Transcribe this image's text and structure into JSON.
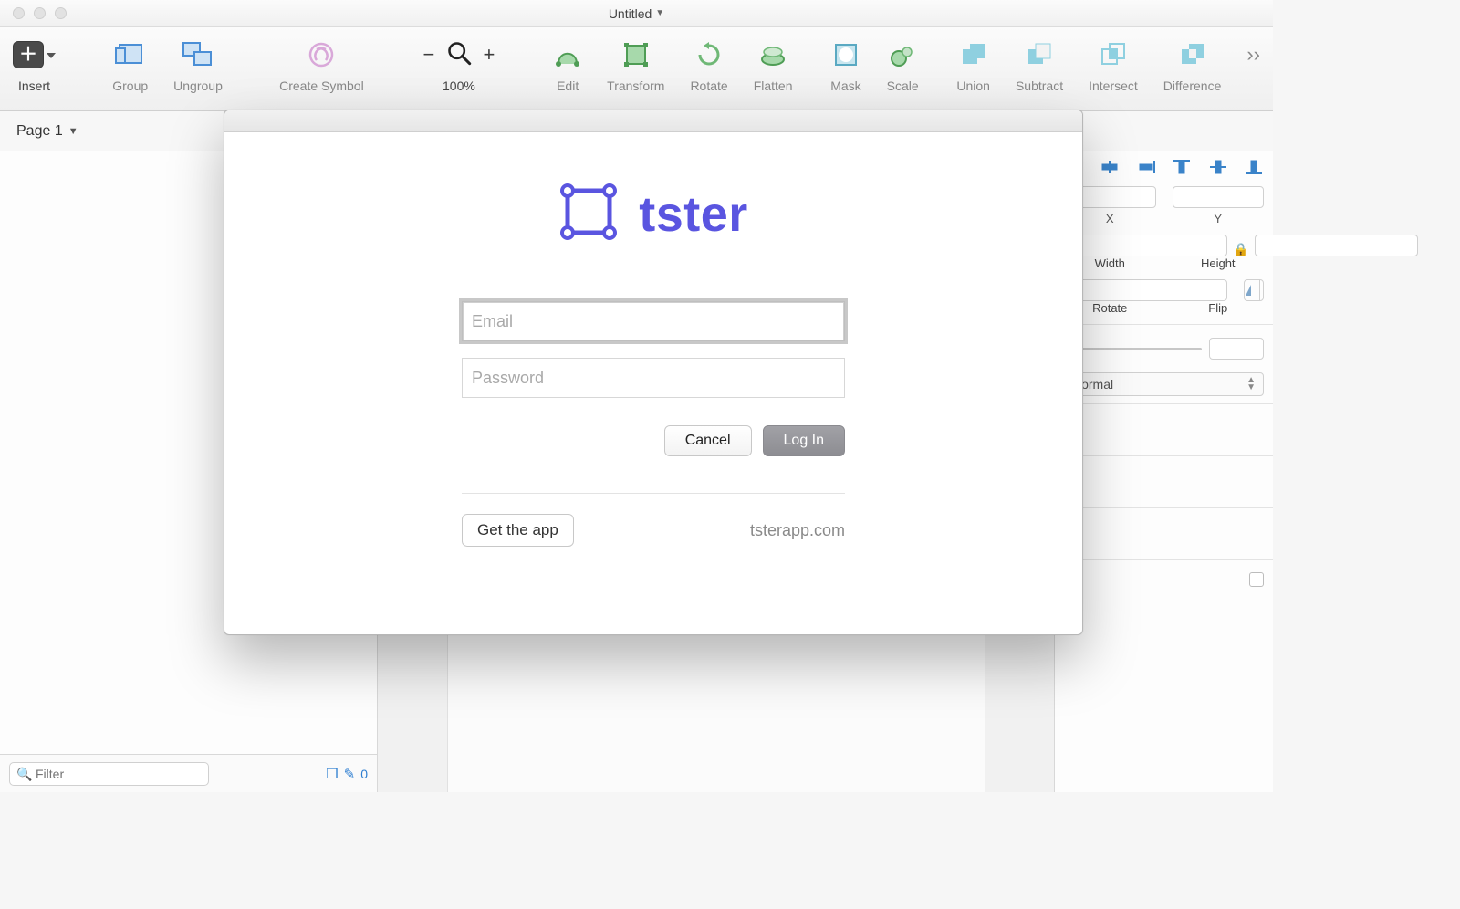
{
  "window": {
    "title": "Untitled"
  },
  "toolbar": {
    "insert": "Insert",
    "group": "Group",
    "ungroup": "Ungroup",
    "create_symbol": "Create Symbol",
    "zoom": "100%",
    "edit": "Edit",
    "transform": "Transform",
    "rotate": "Rotate",
    "flatten": "Flatten",
    "mask": "Mask",
    "scale": "Scale",
    "union": "Union",
    "subtract": "Subtract",
    "intersect": "Intersect",
    "difference": "Difference"
  },
  "pages": {
    "current": "Page 1"
  },
  "filter": {
    "placeholder": "Filter",
    "count": "0"
  },
  "inspector": {
    "x": "X",
    "y": "Y",
    "width": "Width",
    "height": "Height",
    "rotate": "Rotate",
    "flip": "Flip",
    "blend": "Normal"
  },
  "modal": {
    "brand": "tster",
    "email_placeholder": "Email",
    "password_placeholder": "Password",
    "cancel": "Cancel",
    "login": "Log In",
    "get_app": "Get the app",
    "site": "tsterapp.com"
  }
}
